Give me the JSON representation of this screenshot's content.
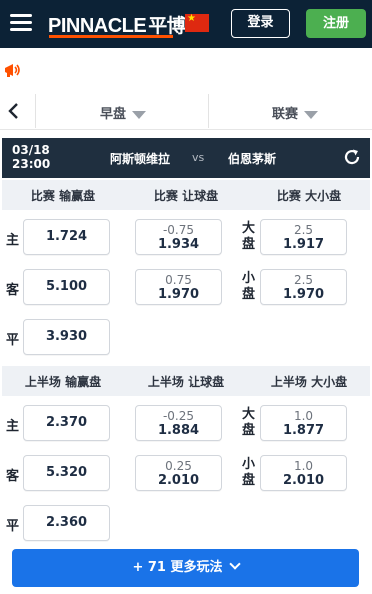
{
  "header": {
    "logo_text": "PINNACLE",
    "logo_cn": "平博",
    "login_label": "登录",
    "register_label": "注册",
    "accent_color": "#ff5100",
    "bg_color": "#0c2236"
  },
  "filters": {
    "period": "早盘",
    "league": "联赛"
  },
  "match": {
    "date": "03/18",
    "time": "23:00",
    "home": "阿斯顿维拉",
    "vs": "vs",
    "away": "伯恩茅斯"
  },
  "full_time": {
    "titles": [
      "比赛 输赢盘",
      "比赛 让球盘",
      "比赛 大小盘"
    ],
    "moneyline": [
      {
        "label": "主",
        "price": "1.724"
      },
      {
        "label": "客",
        "price": "5.100"
      },
      {
        "label": "平",
        "price": "3.930"
      }
    ],
    "handicap": [
      {
        "line": "-0.75",
        "price": "1.934"
      },
      {
        "line": "0.75",
        "price": "1.970"
      }
    ],
    "total": [
      {
        "label": "大盘",
        "line": "2.5",
        "price": "1.917"
      },
      {
        "label": "小盘",
        "line": "2.5",
        "price": "1.970"
      }
    ]
  },
  "first_half": {
    "titles": [
      "上半场 输赢盘",
      "上半场 让球盘",
      "上半场 大小盘"
    ],
    "moneyline": [
      {
        "label": "主",
        "price": "2.370"
      },
      {
        "label": "客",
        "price": "5.320"
      },
      {
        "label": "平",
        "price": "2.360"
      }
    ],
    "handicap": [
      {
        "line": "-0.25",
        "price": "1.884"
      },
      {
        "line": "0.25",
        "price": "2.010"
      }
    ],
    "total": [
      {
        "label": "大盘",
        "line": "1.0",
        "price": "1.877"
      },
      {
        "label": "小盘",
        "line": "1.0",
        "price": "2.010"
      }
    ]
  },
  "more_markets": "+ 71 更多玩法"
}
